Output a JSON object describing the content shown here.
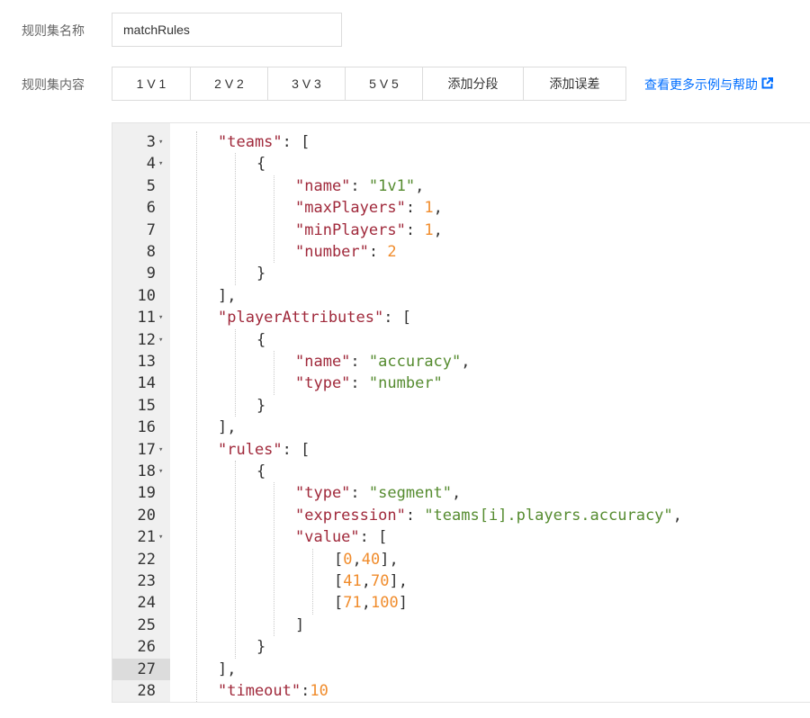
{
  "form": {
    "name_label": "规则集名称",
    "name_value": "matchRules",
    "content_label": "规则集内容"
  },
  "templates": [
    "1 V 1",
    "2 V 2",
    "3 V 3",
    "5 V 5",
    "添加分段",
    "添加误差"
  ],
  "help": {
    "label": "查看更多示例与帮助",
    "icon": "external-link-icon"
  },
  "editor": {
    "active_line": "27",
    "lines": [
      {
        "n": "3",
        "fold": true,
        "indent": 1,
        "tokens": [
          [
            "k",
            "\"teams\""
          ],
          [
            "p",
            ": ["
          ]
        ]
      },
      {
        "n": "4",
        "fold": true,
        "indent": 2,
        "tokens": [
          [
            "p",
            "{"
          ]
        ]
      },
      {
        "n": "5",
        "fold": false,
        "indent": 3,
        "tokens": [
          [
            "k",
            "\"name\""
          ],
          [
            "p",
            ": "
          ],
          [
            "s",
            "\"1v1\""
          ],
          [
            "p",
            ","
          ]
        ]
      },
      {
        "n": "6",
        "fold": false,
        "indent": 3,
        "tokens": [
          [
            "k",
            "\"maxPlayers\""
          ],
          [
            "p",
            ": "
          ],
          [
            "n",
            "1"
          ],
          [
            "p",
            ","
          ]
        ]
      },
      {
        "n": "7",
        "fold": false,
        "indent": 3,
        "tokens": [
          [
            "k",
            "\"minPlayers\""
          ],
          [
            "p",
            ": "
          ],
          [
            "n",
            "1"
          ],
          [
            "p",
            ","
          ]
        ]
      },
      {
        "n": "8",
        "fold": false,
        "indent": 3,
        "tokens": [
          [
            "k",
            "\"number\""
          ],
          [
            "p",
            ": "
          ],
          [
            "n",
            "2"
          ]
        ]
      },
      {
        "n": "9",
        "fold": false,
        "indent": 2,
        "tokens": [
          [
            "p",
            "}"
          ]
        ]
      },
      {
        "n": "10",
        "fold": false,
        "indent": 1,
        "tokens": [
          [
            "p",
            "],"
          ]
        ]
      },
      {
        "n": "11",
        "fold": true,
        "indent": 1,
        "tokens": [
          [
            "k",
            "\"playerAttributes\""
          ],
          [
            "p",
            ": ["
          ]
        ]
      },
      {
        "n": "12",
        "fold": true,
        "indent": 2,
        "tokens": [
          [
            "p",
            "{"
          ]
        ]
      },
      {
        "n": "13",
        "fold": false,
        "indent": 3,
        "tokens": [
          [
            "k",
            "\"name\""
          ],
          [
            "p",
            ": "
          ],
          [
            "s",
            "\"accuracy\""
          ],
          [
            "p",
            ","
          ]
        ]
      },
      {
        "n": "14",
        "fold": false,
        "indent": 3,
        "tokens": [
          [
            "k",
            "\"type\""
          ],
          [
            "p",
            ": "
          ],
          [
            "s",
            "\"number\""
          ]
        ]
      },
      {
        "n": "15",
        "fold": false,
        "indent": 2,
        "tokens": [
          [
            "p",
            "}"
          ]
        ]
      },
      {
        "n": "16",
        "fold": false,
        "indent": 1,
        "tokens": [
          [
            "p",
            "],"
          ]
        ]
      },
      {
        "n": "17",
        "fold": true,
        "indent": 1,
        "tokens": [
          [
            "k",
            "\"rules\""
          ],
          [
            "p",
            ": ["
          ]
        ]
      },
      {
        "n": "18",
        "fold": true,
        "indent": 2,
        "tokens": [
          [
            "p",
            "{"
          ]
        ]
      },
      {
        "n": "19",
        "fold": false,
        "indent": 3,
        "tokens": [
          [
            "k",
            "\"type\""
          ],
          [
            "p",
            ": "
          ],
          [
            "s",
            "\"segment\""
          ],
          [
            "p",
            ","
          ]
        ]
      },
      {
        "n": "20",
        "fold": false,
        "indent": 3,
        "tokens": [
          [
            "k",
            "\"expression\""
          ],
          [
            "p",
            ": "
          ],
          [
            "s",
            "\"teams[i].players.accuracy\""
          ],
          [
            "p",
            ","
          ]
        ]
      },
      {
        "n": "21",
        "fold": true,
        "indent": 3,
        "tokens": [
          [
            "k",
            "\"value\""
          ],
          [
            "p",
            ": ["
          ]
        ]
      },
      {
        "n": "22",
        "fold": false,
        "indent": 4,
        "tokens": [
          [
            "p",
            "["
          ],
          [
            "n",
            "0"
          ],
          [
            "p",
            ","
          ],
          [
            "n",
            "40"
          ],
          [
            "p",
            "],"
          ]
        ]
      },
      {
        "n": "23",
        "fold": false,
        "indent": 4,
        "tokens": [
          [
            "p",
            "["
          ],
          [
            "n",
            "41"
          ],
          [
            "p",
            ","
          ],
          [
            "n",
            "70"
          ],
          [
            "p",
            "],"
          ]
        ]
      },
      {
        "n": "24",
        "fold": false,
        "indent": 4,
        "tokens": [
          [
            "p",
            "["
          ],
          [
            "n",
            "71"
          ],
          [
            "p",
            ","
          ],
          [
            "n",
            "100"
          ],
          [
            "p",
            "]"
          ]
        ]
      },
      {
        "n": "25",
        "fold": false,
        "indent": 3,
        "tokens": [
          [
            "p",
            "]"
          ]
        ]
      },
      {
        "n": "26",
        "fold": false,
        "indent": 2,
        "tokens": [
          [
            "p",
            "}"
          ]
        ]
      },
      {
        "n": "27",
        "fold": false,
        "indent": 1,
        "tokens": [
          [
            "p",
            "],"
          ]
        ]
      },
      {
        "n": "28",
        "fold": false,
        "indent": 1,
        "tokens": [
          [
            "k",
            "\"timeout\""
          ],
          [
            "p",
            ":"
          ],
          [
            "n",
            "10"
          ]
        ]
      }
    ]
  }
}
